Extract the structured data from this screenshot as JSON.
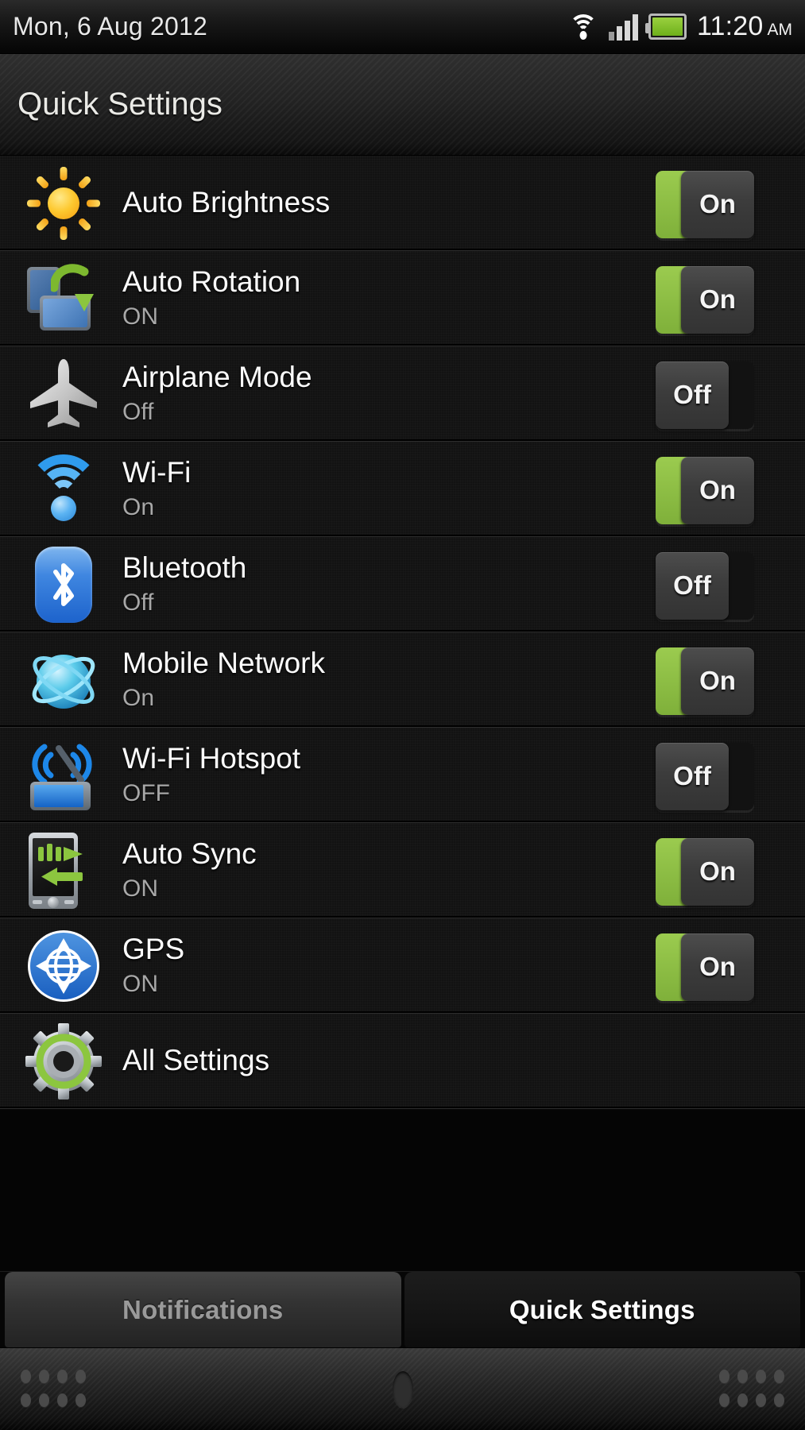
{
  "status_bar": {
    "date": "Mon, 6 Aug 2012",
    "time": "11:20",
    "ampm": "AM",
    "icons": [
      "wifi-icon",
      "signal-bars-icon",
      "battery-icon"
    ]
  },
  "header": {
    "title": "Quick Settings"
  },
  "colors": {
    "toggle_on_green": "#8FBF47",
    "accent_blue": "#2f9bed",
    "row_background": "#121212",
    "text_primary": "#fcfcfc",
    "text_secondary": "#a8a8a8"
  },
  "settings": [
    {
      "icon": "brightness-sun-icon",
      "title": "Auto Brightness",
      "subtitle": "",
      "toggle_label": "On",
      "state": "on"
    },
    {
      "icon": "auto-rotation-icon",
      "title": "Auto Rotation",
      "subtitle": "ON",
      "toggle_label": "On",
      "state": "on"
    },
    {
      "icon": "airplane-icon",
      "title": "Airplane Mode",
      "subtitle": "Off",
      "toggle_label": "Off",
      "state": "off"
    },
    {
      "icon": "wifi-icon",
      "title": "Wi-Fi",
      "subtitle": "On",
      "toggle_label": "On",
      "state": "on"
    },
    {
      "icon": "bluetooth-icon",
      "title": "Bluetooth",
      "subtitle": "Off",
      "toggle_label": "Off",
      "state": "off"
    },
    {
      "icon": "mobile-network-icon",
      "title": "Mobile Network",
      "subtitle": "On",
      "toggle_label": "On",
      "state": "on"
    },
    {
      "icon": "wifi-hotspot-icon",
      "title": "Wi-Fi Hotspot",
      "subtitle": "OFF",
      "toggle_label": "Off",
      "state": "off"
    },
    {
      "icon": "auto-sync-icon",
      "title": "Auto Sync",
      "subtitle": "ON",
      "toggle_label": "On",
      "state": "on"
    },
    {
      "icon": "gps-icon",
      "title": "GPS",
      "subtitle": "ON",
      "toggle_label": "On",
      "state": "on"
    }
  ],
  "all_settings": {
    "icon": "gear-icon",
    "title": "All Settings"
  },
  "tabs": [
    {
      "label": "Notifications",
      "active": false
    },
    {
      "label": "Quick Settings",
      "active": true
    }
  ]
}
